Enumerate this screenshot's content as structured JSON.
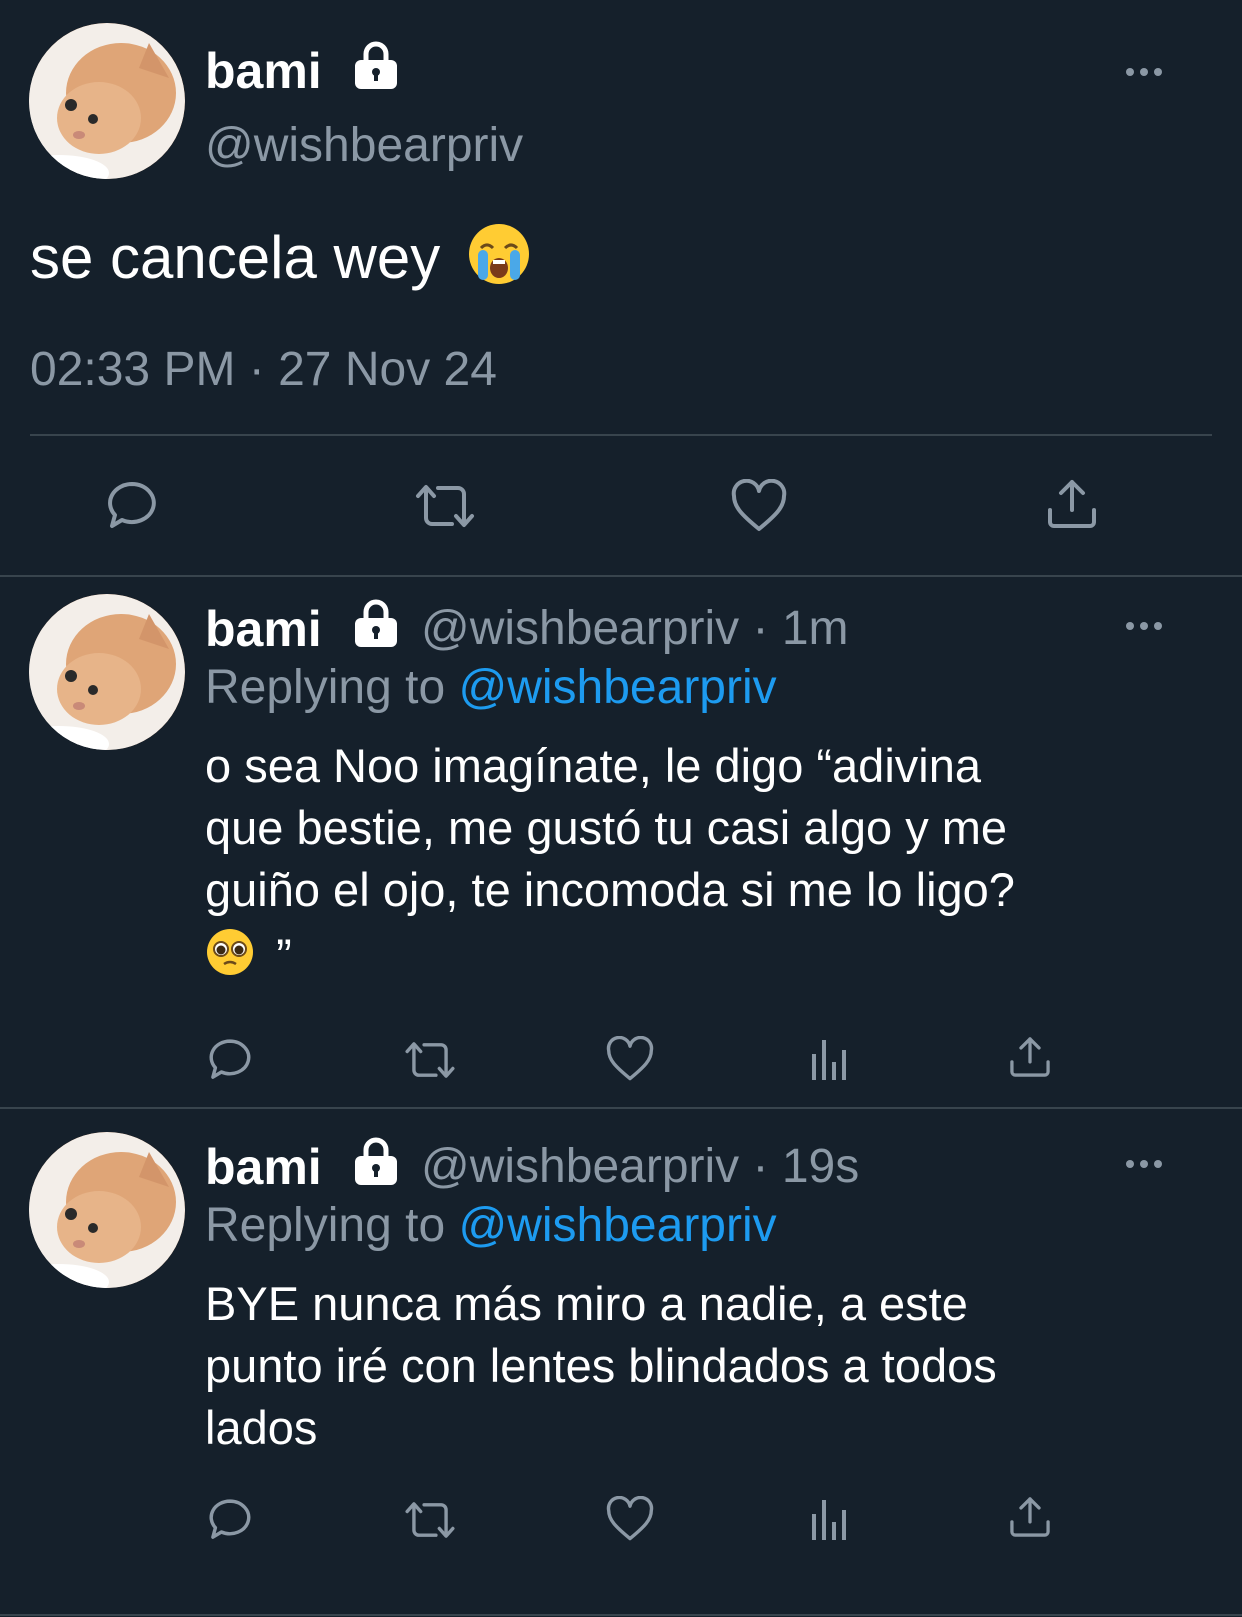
{
  "main_tweet": {
    "display_name": "bami",
    "handle": "@wishbearpriv",
    "text": "se cancela wey",
    "emoji": "loudly-crying-face",
    "timestamp": "02:33 PM · 27 Nov 24",
    "actions": [
      "reply-icon",
      "retweet-icon",
      "like-icon",
      "share-icon"
    ]
  },
  "replies": [
    {
      "display_name": "bami",
      "handle_time": "@wishbearpriv · 1m",
      "replying_prefix": "Replying to",
      "replying_handle": "@wishbearpriv",
      "text_lines": [
        "o sea Noo imagínate, le digo “adivina",
        "que bestie, me gustó tu casi algo y me",
        "guiño el ojo, te incomoda si me lo ligo?"
      ],
      "closing_quote": "”",
      "emoji": "pleading-face"
    },
    {
      "display_name": "bami",
      "handle_time": "@wishbearpriv · 19s",
      "replying_prefix": "Replying to",
      "replying_handle": "@wishbearpriv",
      "text_lines": [
        "BYE nunca más miro a nadie, a este",
        "punto iré con lentes blindados a todos",
        "lados"
      ]
    }
  ],
  "colors": {
    "background": "#15202b",
    "muted": "#8b98a5",
    "link": "#1d9bf0",
    "divider": "#38444d"
  }
}
